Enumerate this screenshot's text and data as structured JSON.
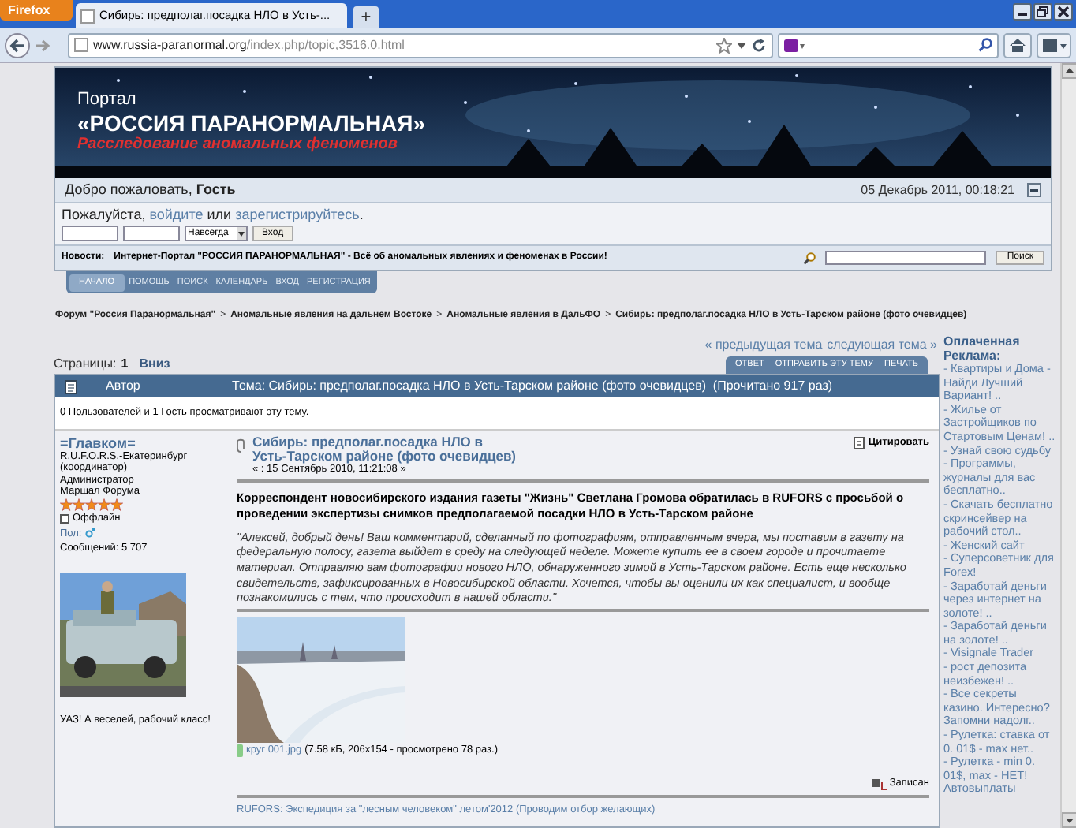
{
  "browser": {
    "menu_button": "Firefox",
    "tab_title": "Сибирь: предполаг.посадка НЛО в Усть-...",
    "new_tab": "+",
    "url_host": "www.russia-paranormal.org",
    "url_path": "/index.php/topic,3516.0.html"
  },
  "banner": {
    "portal": "Портал",
    "name": "«РОССИЯ ПАРАНОРМАЛЬНАЯ»",
    "tagline": "Расследование аномальных феноменов"
  },
  "welcome": {
    "text": "Добро пожаловать, **Гость**",
    "datetime": "05 Декабрь 2011, 00:18:21"
  },
  "login": {
    "prompt": [
      {
        "kind": "text",
        "text": "Пожалуйста, "
      },
      {
        "kind": "link",
        "text": "войдите"
      },
      {
        "kind": "text",
        "text": " или "
      },
      {
        "kind": "link",
        "text": "зарегистрируйтесь"
      },
      {
        "kind": "text",
        "text": "."
      }
    ],
    "duration": "Навсегда",
    "button": "Вход"
  },
  "news": {
    "label": "Новости:",
    "text": "Интернет-Портал \"РОССИЯ ПАРАНОРМАЛЬНАЯ\" - Всё об аномальных явлениях и феноменах в России!",
    "search_button": "Поиск"
  },
  "menu": [
    {
      "label": "НАЧАЛО",
      "selected": true
    },
    {
      "label": "ПОМОЩЬ",
      "selected": false
    },
    {
      "label": "ПОИСК",
      "selected": false
    },
    {
      "label": "КАЛЕНДАРЬ",
      "selected": false
    },
    {
      "label": "ВХОД",
      "selected": false
    },
    {
      "label": "РЕГИСТРАЦИЯ",
      "selected": false
    }
  ],
  "breadcrumb": [
    {
      "text": "Форум \"Россия Паранормальная\""
    },
    {
      "separator": ">",
      "text": "Аномальные явления на дальнем Востоке"
    },
    {
      "separator": ">",
      "text": "Аномальные явления в ДальФО"
    },
    {
      "separator": ">",
      "text": "Сибирь: предполаг.посадка НЛО в Усть-Тарском районе (фото очевидцев)"
    }
  ],
  "topic_nav": {
    "previous": "« предыдущая тема",
    "next": "следующая тема »"
  },
  "pages": {
    "label": "Страницы:",
    "current": "1",
    "down": "Вниз"
  },
  "topic_buttons": [
    "ОТВЕТ",
    "ОТПРАВИТЬ ЭТУ ТЕМУ",
    "ПЕЧАТЬ"
  ],
  "header": {
    "author": "Автор",
    "topic": "Тема: Сибирь: предполаг.посадка НЛО в Усть-Тарском районе (фото очевидцев)  (Прочитано 917 раз)"
  },
  "viewers": "0 Пользователей и 1 Гость просматривают эту тему.",
  "post": {
    "author": {
      "name": "=Главком=",
      "lines": [
        "R.U.F.O.R.S.-Екатеринбург",
        "(координатор)",
        "Администратор",
        "Маршал Форума"
      ],
      "stars": 5,
      "online": false,
      "status": "Оффлайн",
      "gender_label": "Пол:",
      "posts": "Сообщений: 5 707",
      "signature": "УАЗ! А веселей, рабочий класс!"
    },
    "title": "Сибирь: предполаг.посадка НЛО в Усть-Тарском районе (фото очевидцев)",
    "date": "« : 15 Сентябрь 2010, 11:21:08 »",
    "quote_button": "Цитировать",
    "lead": "Корреспондент новосибирского издания газеты \"Жизнь\" Светлана Громова обратилась в RUFORS с просьбой о проведении экспертизы снимков предполагаемой посадки НЛО в Усть-Тарском районе",
    "quote": "\"Алексей, добрый день! Ваш комментарий, сделанный по фотографиям, отправленным вчера, мы поставим в газету на федеральную полосу, газета выйдет в среду на следующей неделе. Можете купить ее в своем городе и прочитаете материал.  Отправляю вам фотографии нового НЛО, обнаруженного зимой в Усть-Тарском районе. Есть еще несколько свидетельств, зафиксированных в Новосибирской области. Хочется, чтобы вы оценили их как специалист, и вообще познакомились с тем, что происходит в нашей области.\"",
    "attachment": {
      "file": "круг 001.jpg",
      "info": "(7.58 кБ, 206x154 - просмотрено 78 раз.)"
    },
    "logged": "Записан",
    "signature_link": "RUFORS: Экспедиция за \"лесным человеком\" летом'2012 (Проводим отбор желающих)"
  },
  "ads": {
    "title": "Оплаченная Реклама:",
    "items": [
      "- Квартиры и Дома - Найди Лучший Вариант! ..",
      "- Жилье от Застройщиков по Стартовым Ценам! ..",
      "- Узнай свою судьбу",
      "- Программы, журналы для вас бесплатно..",
      "- Скачать бесплатно скринсейвер на рабочий стол..",
      "- Женский сайт",
      "- Суперсоветник для Forex!",
      "- Заработай деньги через интернет на золоте! ..",
      "- Заработай деньги на золоте! ..",
      "- Visignale Trader",
      "- рост депозита неизбежен! ..",
      "- Все секреты казино. Интересно? Запомни надолг..",
      "- Рулетка: ставка от 0. 01$ - max нет..",
      "- Рулетка - min 0. 01$, max - НЕТ!",
      "Автовыплаты"
    ]
  }
}
